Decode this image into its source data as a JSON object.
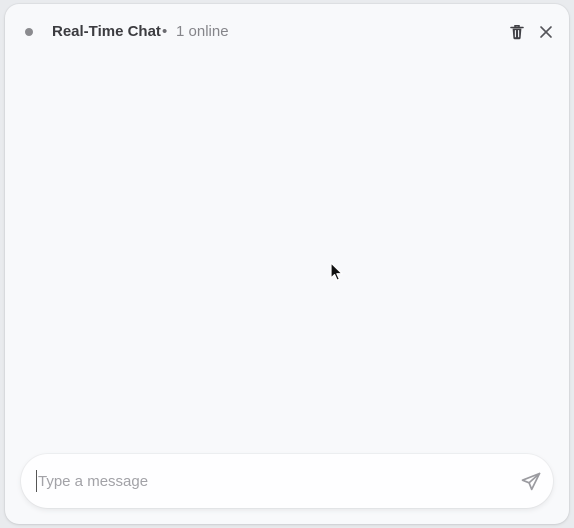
{
  "header": {
    "title": "Real-Time Chat",
    "separator": "•",
    "online_count": "1 online",
    "status_dot_color": "#8b8b8f",
    "delete_icon": "trash-icon",
    "close_icon": "close-icon"
  },
  "messages": [],
  "composer": {
    "placeholder": "Type a message",
    "value": "",
    "send_icon": "send-icon"
  }
}
